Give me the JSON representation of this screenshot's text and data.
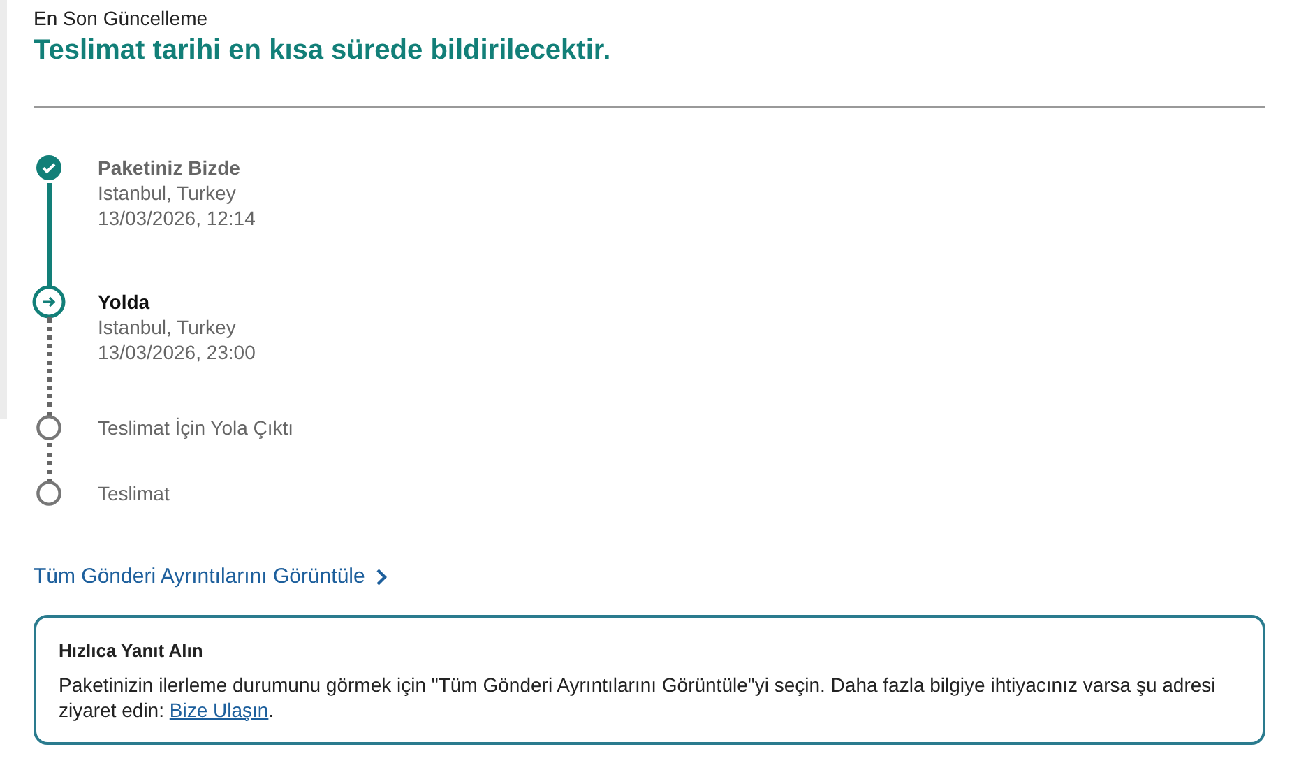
{
  "update": {
    "label": "En Son Güncelleme",
    "headline": "Teslimat tarihi en kısa sürede bildirilecektir."
  },
  "steps": [
    {
      "kind": "done",
      "title": "Paketiniz Bizde",
      "lines": [
        "Istanbul, Turkey",
        "13/03/2026, 12:14"
      ]
    },
    {
      "kind": "current",
      "title": "Yolda",
      "lines": [
        "Istanbul, Turkey",
        "13/03/2026, 23:00"
      ]
    },
    {
      "kind": "pending",
      "title": "Teslimat İçin Yola Çıktı"
    },
    {
      "kind": "pending",
      "title": "Teslimat"
    }
  ],
  "details_link": "Tüm Gönderi Ayrıntılarını Görüntüle",
  "info": {
    "title": "Hızlıca Yanıt Alın",
    "text_before": "Paketinizin ilerleme durumunu görmek için \"Tüm Gönderi Ayrıntılarını Görüntüle\"yi seçin. Daha fazla bilgiye ihtiyacınız varsa şu adresi ziyaret edin: ",
    "link": "Bize Ulaşın",
    "text_after": "."
  }
}
